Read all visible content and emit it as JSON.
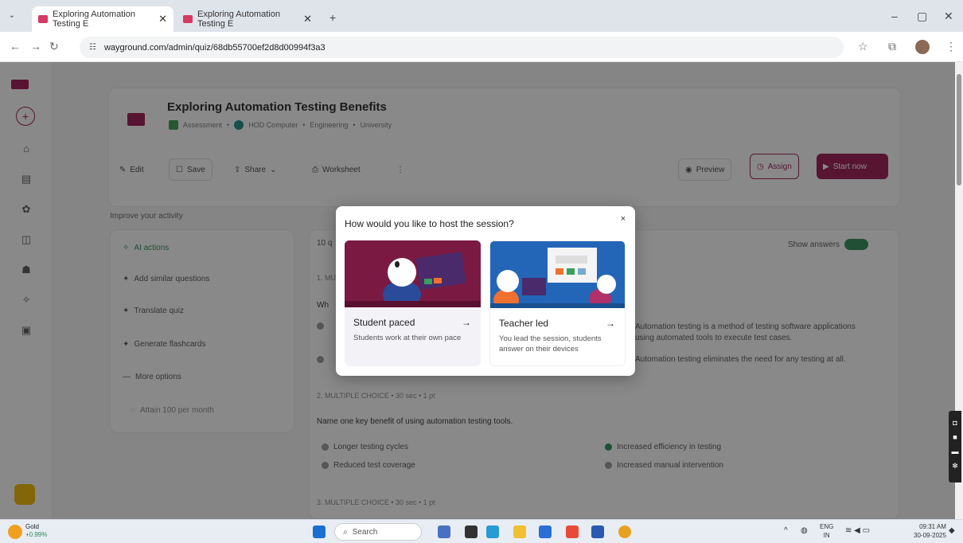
{
  "browser": {
    "tabs": [
      {
        "title": "Exploring Automation Testing E"
      },
      {
        "title": "Exploring Automation Testing E"
      }
    ],
    "new_tab": "+",
    "url": "wayground.com/admin/quiz/68db55700ef2d8d00994f3a3"
  },
  "quiz": {
    "title": "Exploring Automation Testing Benefits",
    "meta_type": "Assessment",
    "meta_owner": "HOD Computer",
    "meta_subject": "Engineering",
    "meta_level": "University"
  },
  "toolbar": {
    "edit": "Edit",
    "save": "Save",
    "share": "Share",
    "worksheet": "Worksheet",
    "more": "⋮",
    "preview": "Preview",
    "assign": "Assign",
    "start_now": "Start now"
  },
  "improve_panel": {
    "heading": "Improve your activity",
    "items": [
      {
        "label": "AI actions"
      },
      {
        "label": "Add similar questions"
      },
      {
        "label": "Translate quiz"
      },
      {
        "label": "Generate flashcards"
      },
      {
        "label": "More options"
      }
    ],
    "footer": "Attain 100 per month"
  },
  "questions": {
    "show_answers": "Show answers",
    "count": "10 q",
    "q1_head": "1. MU",
    "q1_text": "Wh",
    "q1_opt_c": "Automation testing is a method of testing software applications using automated tools to execute test cases.",
    "q1_opt_d": "Automation testing eliminates the need for any testing at all.",
    "q2_head": "2. MULTIPLE CHOICE • 30 sec • 1 pt",
    "q2_text": "Name one key benefit of using automation testing tools.",
    "q2_options": [
      "Longer testing cycles",
      "Increased efficiency in testing",
      "Reduced test coverage",
      "Increased manual intervention"
    ],
    "q3_head": "3. MULTIPLE CHOICE • 30 sec • 1 pt"
  },
  "modal": {
    "title": "How would you like to host the session?",
    "close": "×",
    "options": [
      {
        "title": "Student paced",
        "description": "Students work at their own pace"
      },
      {
        "title": "Teacher led",
        "description": "You lead the session, students answer on their devices"
      }
    ],
    "arrow": "→"
  },
  "taskbar": {
    "stock_name": "Gold",
    "stock_change": "+0.99%",
    "search": "Search",
    "lang_top": "ENG",
    "lang_bottom": "IN",
    "time": "09:31 AM",
    "date": "30-09-2025"
  },
  "colors": {
    "brand": "#9a1750",
    "toggle": "#2e8b57",
    "student_card": "#7a1a42",
    "teacher_card": "#2366b8"
  }
}
